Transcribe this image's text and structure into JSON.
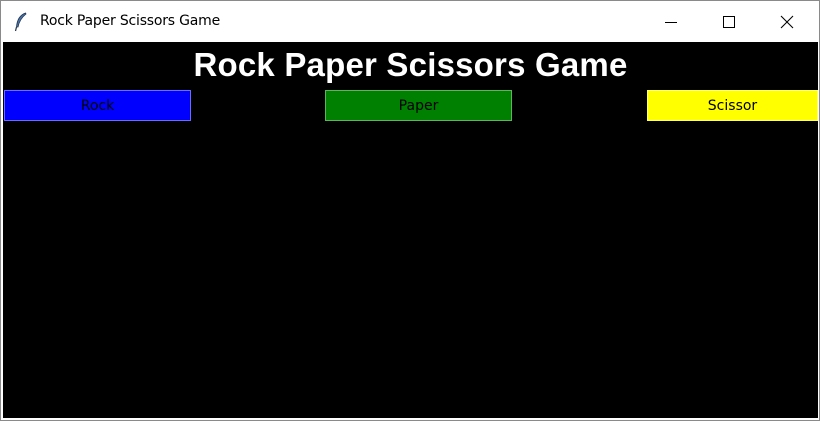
{
  "window": {
    "title": "Rock Paper Scissors Game",
    "icon": "feather-icon",
    "controls": {
      "minimize_icon": "minimize-icon",
      "maximize_icon": "maximize-icon",
      "close_icon": "close-icon"
    }
  },
  "main": {
    "heading": "Rock Paper Scissors Game",
    "background": "#000000",
    "heading_color": "#ffffff",
    "choices": [
      {
        "label": "Rock",
        "color": "#0000ff"
      },
      {
        "label": "Paper",
        "color": "#008000"
      },
      {
        "label": "Scissor",
        "color": "#ffff00"
      }
    ]
  }
}
